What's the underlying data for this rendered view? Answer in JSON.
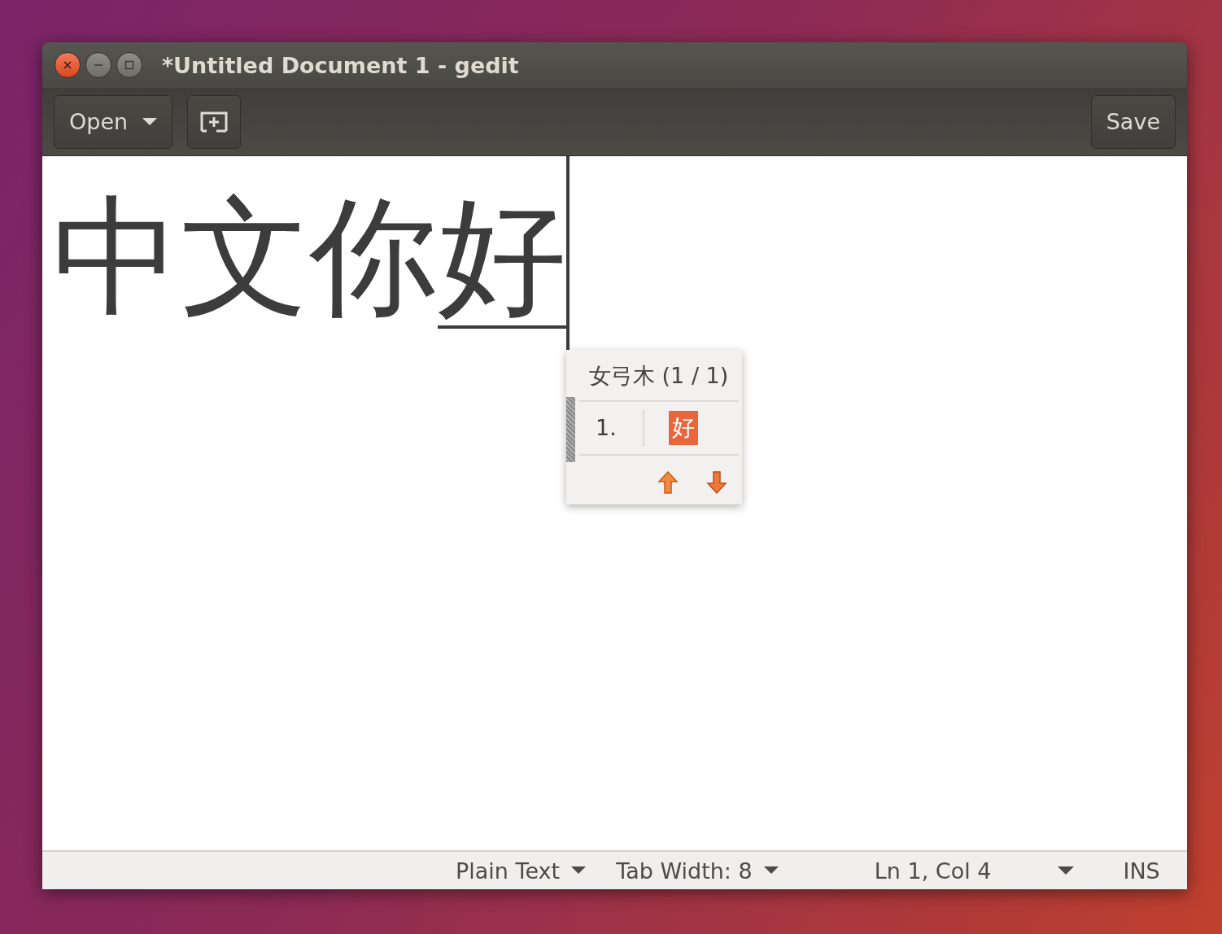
{
  "window": {
    "title": "*Untitled Document 1 - gedit"
  },
  "toolbar": {
    "open_label": "Open",
    "save_label": "Save"
  },
  "editor": {
    "committed_text": "中文你",
    "preedit_text": "好"
  },
  "candidate_popup": {
    "header": "女弓木 (1 / 1)",
    "candidates": [
      {
        "index": "1.",
        "text": "好",
        "selected": true
      }
    ]
  },
  "status_bar": [
    {
      "kind": "dropdown",
      "label": "Plain Text"
    },
    {
      "kind": "dropdown",
      "label": "Tab Width: 8"
    },
    {
      "kind": "text",
      "label": "Ln 1, Col 4"
    },
    {
      "kind": "arrow"
    },
    {
      "kind": "text",
      "label": "INS"
    }
  ]
}
